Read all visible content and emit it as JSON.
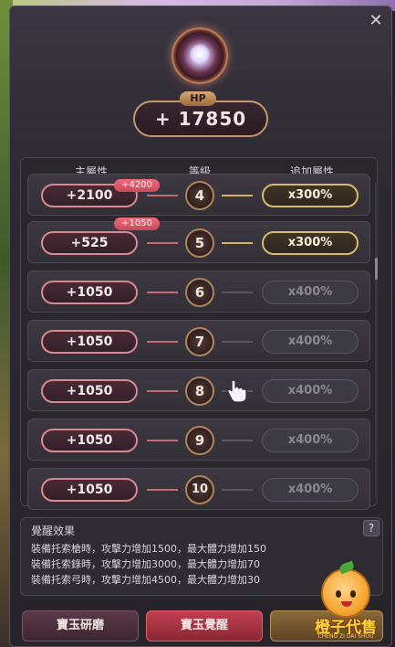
{
  "header": {
    "hp_label": "HP",
    "hp_value": "+ 17850",
    "close_symbol": "✕"
  },
  "table": {
    "headers": [
      "主屬性",
      "等級",
      "追加屬性"
    ],
    "rows": [
      {
        "stat": "+2100",
        "badge": "+4200",
        "level": "4",
        "multiplier": "x300%",
        "active": true
      },
      {
        "stat": "+525",
        "badge": "+1050",
        "level": "5",
        "multiplier": "x300%",
        "active": true
      },
      {
        "stat": "+1050",
        "badge": "",
        "level": "6",
        "multiplier": "x400%",
        "active": false
      },
      {
        "stat": "+1050",
        "badge": "",
        "level": "7",
        "multiplier": "x400%",
        "active": false
      },
      {
        "stat": "+1050",
        "badge": "",
        "level": "8",
        "multiplier": "x400%",
        "active": false
      },
      {
        "stat": "+1050",
        "badge": "",
        "level": "9",
        "multiplier": "x400%",
        "active": false
      },
      {
        "stat": "+1050",
        "badge": "",
        "level": "10",
        "multiplier": "x400%",
        "active": false
      }
    ]
  },
  "effect": {
    "title": "覺醒效果",
    "help": "?",
    "lines": [
      "裝備托索槍時，攻擊力增加1500，最大體力增加150",
      "裝備托索錄時，攻擊力增加3000，最大體力增加70",
      "裝備托索弓時，攻擊力增加4500，最大體力增加30"
    ]
  },
  "buttons": {
    "polish": "寶玉研磨",
    "awaken": "寶玉覺醒",
    "third": "1"
  },
  "watermark": {
    "text": "橙子代售",
    "sub": "CHENG ZI DAI SHOU"
  },
  "colors": {
    "accent_red": "#c24050",
    "gold": "#d8bb6c",
    "stat_border": "#d98a8e"
  }
}
